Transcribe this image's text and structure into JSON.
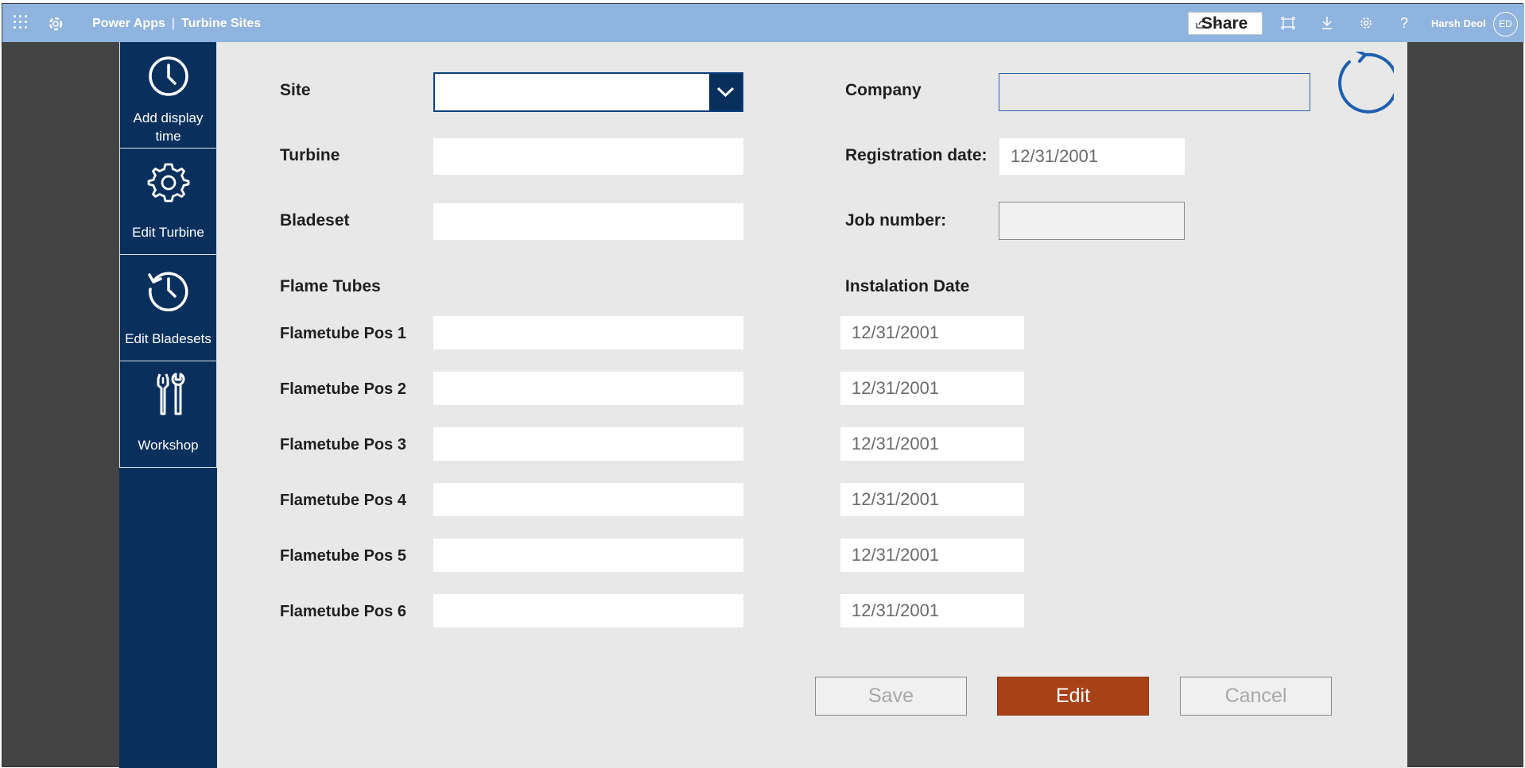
{
  "header": {
    "app_name": "Power Apps",
    "separator": "|",
    "screen_title": "Turbine Sites",
    "share_label": "Share",
    "help_glyph": "?",
    "user_name": "Harsh Deol",
    "avatar_initials": "ED",
    "colors": {
      "bar": "#8eb4df"
    }
  },
  "nav": {
    "items": [
      {
        "label_line1": "Add display",
        "label_line2": "time",
        "icon": "clock-icon"
      },
      {
        "label": "Edit Turbine",
        "icon": "gear-icon"
      },
      {
        "label": "Edit Bladesets",
        "icon": "history-icon"
      },
      {
        "label": "Workshop",
        "icon": "tools-icon"
      }
    ],
    "colors": {
      "background": "#09305d"
    }
  },
  "form": {
    "site_label": "Site",
    "site_value": "",
    "turbine_label": "Turbine",
    "turbine_value": "",
    "bladeset_label": "Bladeset",
    "bladeset_value": "",
    "company_label": "Company",
    "company_value": "",
    "registration_label": "Registration date:",
    "registration_value": "12/31/2001",
    "job_label": "Job number:",
    "job_value": "",
    "flame_tubes_heading": "Flame Tubes",
    "installation_heading": "Instalation Date",
    "flametubes": [
      {
        "label": "Flametube Pos 1",
        "value": "",
        "date": "12/31/2001"
      },
      {
        "label": "Flametube Pos 2",
        "value": "",
        "date": "12/31/2001"
      },
      {
        "label": "Flametube Pos 3",
        "value": "",
        "date": "12/31/2001"
      },
      {
        "label": "Flametube Pos 4",
        "value": "",
        "date": "12/31/2001"
      },
      {
        "label": "Flametube Pos 5",
        "value": "",
        "date": "12/31/2001"
      },
      {
        "label": "Flametube Pos 6",
        "value": "",
        "date": "12/31/2001"
      }
    ]
  },
  "actions": {
    "save_label": "Save",
    "edit_label": "Edit",
    "cancel_label": "Cancel",
    "colors": {
      "edit": "#a94117"
    }
  },
  "icons": {
    "refresh": "refresh-icon"
  }
}
